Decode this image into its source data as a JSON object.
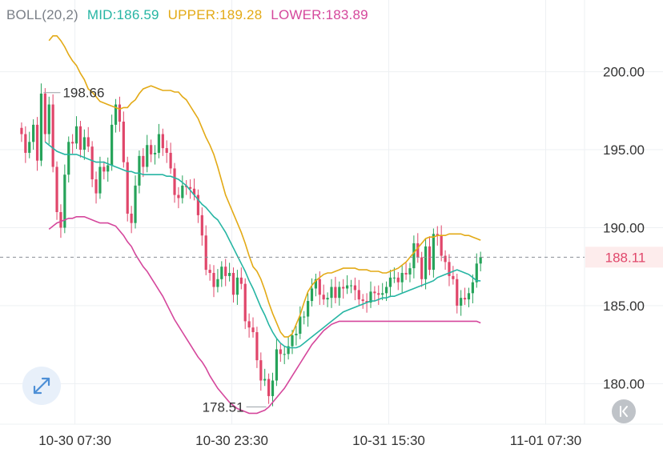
{
  "chart_data": {
    "type": "candlestick",
    "indicator": {
      "name": "BOLL(20,2)",
      "mid_label": "MID:",
      "mid_value": "186.59",
      "upper_label": "UPPER:",
      "upper_value": "189.28",
      "lower_label": "LOWER:",
      "lower_value": "183.89"
    },
    "y_ticks": [
      "200.00",
      "195.00",
      "190.00",
      "185.00",
      "180.00"
    ],
    "y_tick_values": [
      200,
      195,
      190,
      185,
      180
    ],
    "ylim": [
      177.4,
      204.6
    ],
    "x_ticks": [
      "10-30 07:30",
      "10-30 23:30",
      "10-31 15:30",
      "11-01 07:30"
    ],
    "x_tick_positions": [
      13.6,
      53.6,
      93.6,
      133.6
    ],
    "xlim": [
      -5.5,
      143.5
    ],
    "current_price": 188.11,
    "current_price_label": "188.11",
    "max_annotation": {
      "label": "198.66",
      "index": 5,
      "value": 198.66
    },
    "min_annotation": {
      "label": "178.51",
      "index": 63,
      "value": 178.51
    },
    "colors": {
      "up": "#26a35a",
      "down": "#e0466a",
      "mid": "#26b5a3",
      "upper": "#e3aa16",
      "lower": "#d5479c",
      "grid": "#edf0f3",
      "axis_text": "#333333",
      "price_tag_bg": "#fdecec",
      "price_tag_text": "#e0466a"
    },
    "close": [
      196.0,
      194.8,
      195.5,
      196.6,
      194.3,
      198.6,
      196.0,
      197.9,
      193.9,
      191.0,
      190.0,
      193.4,
      195.5,
      195.4,
      196.5,
      195.0,
      195.8,
      195.2,
      193.1,
      192.2,
      193.9,
      193.6,
      194.0,
      196.6,
      197.9,
      196.8,
      194.2,
      190.9,
      190.3,
      192.7,
      194.6,
      193.9,
      195.3,
      194.7,
      194.8,
      196.0,
      195.1,
      194.8,
      193.8,
      192.1,
      191.9,
      192.7,
      192.6,
      192.5,
      192.1,
      190.8,
      189.5,
      187.3,
      187.1,
      186.2,
      186.7,
      187.5,
      186.9,
      187.1,
      185.7,
      186.8,
      186.4,
      184.0,
      183.6,
      183.3,
      181.5,
      180.2,
      180.3,
      179.2,
      180.2,
      182.2,
      181.9,
      181.9,
      182.4,
      183.1,
      183.2,
      184.3,
      184.3,
      185.3,
      186.1,
      186.7,
      185.7,
      185.4,
      185.5,
      186.2,
      185.5,
      186.2,
      186.1,
      186.3,
      186.3,
      186.0,
      185.4,
      185.3,
      185.2,
      185.9,
      185.8,
      185.7,
      185.8,
      186.2,
      186.8,
      186.8,
      186.5,
      187.1,
      187.0,
      187.4,
      189.0,
      188.1,
      186.7,
      188.8,
      187.3,
      189.6,
      189.5,
      188.2,
      187.8,
      186.9,
      186.7,
      185.0,
      185.5,
      185.4,
      185.8,
      186.5,
      187.7,
      188.11
    ],
    "upper": [
      202.0,
      202.3,
      202.3,
      202.0,
      201.6,
      201.1,
      200.7,
      200.4,
      199.9,
      199.5,
      198.9,
      198.7,
      198.4,
      198.1,
      198.0,
      197.9,
      197.8,
      197.7,
      197.6,
      197.7,
      197.7,
      198.0,
      198.2,
      198.6,
      198.9,
      199.0,
      199.1,
      199.0,
      198.9,
      198.8,
      198.8,
      198.8,
      198.7,
      198.7,
      198.4,
      198.2,
      197.8,
      197.4,
      197.0,
      196.4,
      195.8,
      195.3,
      194.7,
      193.9,
      193.0,
      192.1,
      191.5,
      190.9,
      190.3,
      189.7,
      189.0,
      188.2,
      187.5,
      187.2,
      186.7,
      186.0,
      185.2,
      184.5,
      183.9,
      183.3,
      183.0,
      183.0,
      183.2,
      183.8,
      184.4,
      185.2,
      185.9,
      186.3,
      186.6,
      186.8,
      187.0,
      187.1,
      187.1,
      187.2,
      187.3,
      187.4,
      187.4,
      187.4,
      187.4,
      187.3,
      187.3,
      187.3,
      187.2,
      187.2,
      187.2,
      187.1,
      187.1,
      187.2,
      187.3,
      187.4,
      187.6,
      187.8,
      188.1,
      188.4,
      188.7,
      189.0,
      189.3,
      189.4,
      189.4,
      189.5,
      189.5,
      189.5,
      189.6,
      189.6,
      189.6,
      189.6,
      189.5,
      189.5,
      189.4,
      189.3,
      189.2
    ],
    "mid": [
      195.5,
      195.3,
      195.1,
      194.9,
      194.8,
      194.7,
      194.7,
      194.7,
      194.7,
      194.6,
      194.5,
      194.4,
      194.3,
      194.2,
      194.2,
      194.2,
      194.1,
      194.0,
      193.9,
      193.8,
      193.7,
      193.6,
      193.6,
      193.5,
      193.5,
      193.4,
      193.4,
      193.4,
      193.4,
      193.4,
      193.4,
      193.3,
      193.3,
      193.2,
      193.1,
      192.9,
      192.7,
      192.4,
      192.1,
      191.8,
      191.5,
      191.3,
      191.0,
      190.7,
      190.5,
      190.1,
      189.7,
      189.2,
      188.7,
      188.2,
      187.7,
      187.2,
      186.6,
      186.1,
      185.5,
      184.9,
      184.4,
      183.8,
      183.3,
      182.9,
      182.6,
      182.4,
      182.3,
      182.3,
      182.3,
      182.4,
      182.6,
      182.8,
      183.0,
      183.2,
      183.4,
      183.6,
      183.8,
      184.0,
      184.2,
      184.4,
      184.6,
      184.7,
      184.8,
      184.9,
      185.0,
      185.1,
      185.2,
      185.3,
      185.3,
      185.4,
      185.5,
      185.5,
      185.6,
      185.6,
      185.7,
      185.8,
      185.9,
      186.0,
      186.1,
      186.2,
      186.3,
      186.4,
      186.5,
      186.6,
      186.8,
      186.9,
      187.0,
      187.1,
      187.2,
      187.3,
      187.2,
      187.1,
      187.0,
      186.8,
      186.6,
      186.59
    ],
    "lower": [
      189.9,
      190.1,
      190.3,
      190.4,
      190.5,
      190.6,
      190.6,
      190.7,
      190.7,
      190.7,
      190.6,
      190.5,
      190.4,
      190.3,
      190.3,
      190.3,
      190.2,
      190.1,
      189.8,
      189.5,
      189.1,
      188.8,
      188.3,
      187.9,
      187.5,
      187.2,
      186.8,
      186.4,
      186.0,
      185.6,
      185.1,
      184.6,
      184.1,
      183.7,
      183.3,
      182.9,
      182.5,
      182.1,
      181.7,
      181.4,
      181.0,
      180.5,
      180.1,
      179.7,
      179.4,
      179.1,
      178.8,
      178.6,
      178.4,
      178.3,
      178.2,
      178.1,
      178.1,
      178.1,
      178.2,
      178.3,
      178.5,
      178.8,
      179.1,
      179.4,
      179.7,
      180.1,
      180.5,
      180.9,
      181.3,
      181.7,
      182.1,
      182.5,
      182.8,
      183.1,
      183.4,
      183.6,
      183.8,
      183.9,
      184.0,
      184.0,
      184.0,
      184.0,
      184.0,
      184.0,
      184.0,
      184.0,
      184.0,
      184.0,
      184.0,
      184.0,
      184.0,
      184.0,
      184.0,
      184.0,
      184.0,
      184.0,
      184.0,
      184.0,
      184.0,
      184.0,
      184.0,
      184.0,
      184.0,
      184.0,
      184.0,
      184.0,
      184.0,
      184.0,
      184.0,
      184.0,
      184.0,
      184.0,
      184.0,
      184.0,
      183.89
    ]
  }
}
